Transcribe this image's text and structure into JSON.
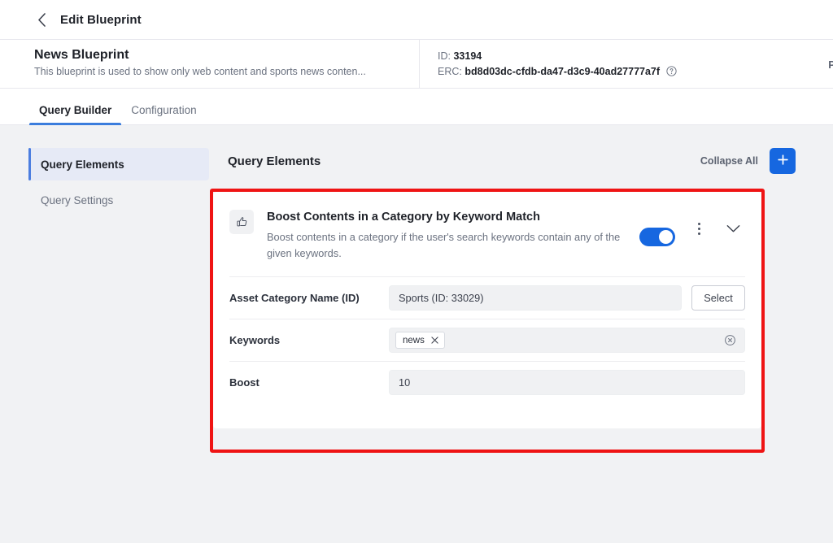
{
  "topbar": {
    "back_icon": "chevron-left-icon",
    "title": "Edit Blueprint"
  },
  "blueprint_header": {
    "name": "News Blueprint",
    "description": "This blueprint is used to show only web content and sports news conten...",
    "id_label": "ID:",
    "id_value": "33194",
    "erc_label": "ERC:",
    "erc_value": "bd8d03dc-cfdb-da47-d3c9-40ad27777a7f",
    "help_icon": "help-circle-icon",
    "preview_label": "Previ"
  },
  "tabs": [
    {
      "label": "Query Builder",
      "active": true
    },
    {
      "label": "Configuration",
      "active": false
    }
  ],
  "sidebar": {
    "items": [
      {
        "label": "Query Elements",
        "active": true
      },
      {
        "label": "Query Settings",
        "active": false
      }
    ]
  },
  "main": {
    "title": "Query Elements",
    "collapse_all_label": "Collapse All",
    "add_button_icon": "plus-icon"
  },
  "card": {
    "icon": "thumbs-up-icon",
    "title": "Boost Contents in a Category by Keyword Match",
    "description": "Boost contents in a category if the user's search keywords contain any of the given keywords.",
    "toggle_on": true,
    "menu_icon": "kebab-menu-icon",
    "collapse_icon": "chevron-down-icon",
    "fields": [
      {
        "label": "Asset Category Name (ID)",
        "type": "text-with-button",
        "value": "Sports (ID: 33029)",
        "button_label": "Select"
      },
      {
        "label": "Keywords",
        "type": "chips",
        "chips": [
          "news"
        ],
        "clear_icon": "clear-circle-icon"
      },
      {
        "label": "Boost",
        "type": "text",
        "value": "10"
      }
    ]
  },
  "colors": {
    "accent_blue": "#1667e0",
    "tab_underline": "#3b7ddd",
    "highlight_red": "#ef1414",
    "page_bg": "#f1f2f4",
    "sidebar_active_bg": "#e6eaf6"
  }
}
